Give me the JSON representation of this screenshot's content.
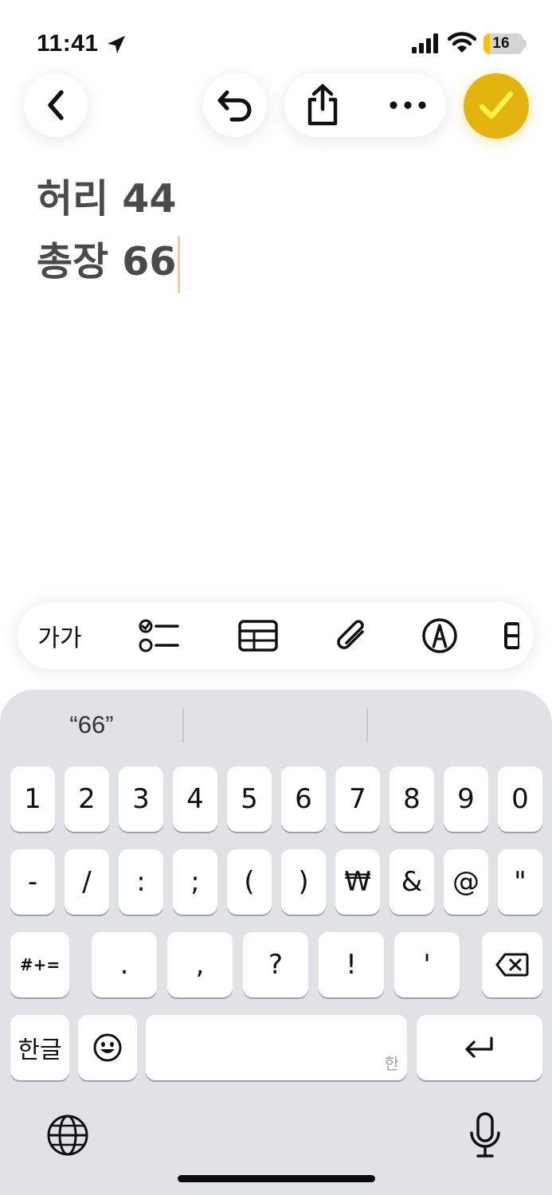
{
  "status_bar": {
    "time": "11:41",
    "battery_level": "16",
    "icons": [
      "location-arrow-icon",
      "cellular-signal-icon",
      "wifi-icon",
      "battery-icon"
    ]
  },
  "toolbar": {
    "icons": [
      "chevron-left-icon",
      "undo-icon",
      "share-icon",
      "more-icon",
      "checkmark-icon"
    ],
    "accent_color": "#e2b40d"
  },
  "note": {
    "lines": [
      "허리 44",
      "총장 66"
    ]
  },
  "format_bar": {
    "text_style_label": "가가",
    "icons": [
      "checklist-icon",
      "table-icon",
      "paperclip-icon",
      "markup-pen-icon",
      "more-tools-icon"
    ]
  },
  "keyboard": {
    "suggestions": [
      "“66”",
      "",
      ""
    ],
    "row1": [
      "1",
      "2",
      "3",
      "4",
      "5",
      "6",
      "7",
      "8",
      "9",
      "0"
    ],
    "row2": [
      "-",
      "/",
      ":",
      ";",
      "(",
      ")",
      "₩",
      "&",
      "@",
      "\""
    ],
    "row3": [
      "#+=",
      ".",
      ",",
      "?",
      "!",
      "'"
    ],
    "row4": {
      "mode_key": "한글",
      "space_hint": "한"
    },
    "icons": [
      "delete-icon",
      "emoji-icon",
      "return-icon",
      "globe-icon",
      "microphone-icon"
    ],
    "background": "#e1e2e6"
  }
}
